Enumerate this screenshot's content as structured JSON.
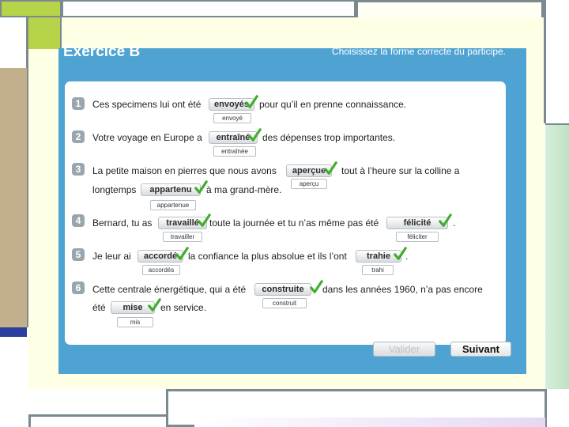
{
  "exercise": {
    "title": "Exercice B",
    "instruction": "Choisissez la forme correcte du participe."
  },
  "questions": [
    {
      "number": "1",
      "text_before": "Ces specimens lui ont été",
      "answer": "envoyés",
      "correction": "envoyé",
      "text_after": "pour qu’il en prenne connaissance."
    },
    {
      "number": "2",
      "text_before": "Votre voyage en Europe a",
      "answer": "entraîné",
      "correction": "entraînée",
      "text_after": "des dépenses trop importantes."
    },
    {
      "number": "3",
      "text_before": "La petite maison en pierres que nous avons",
      "answer": "aperçue",
      "correction": "aperçu",
      "text_after": "tout à l’heure sur la colline a",
      "line2_before": "longtemps",
      "answer2": "appartenu",
      "correction2": "appartenue",
      "line2_after": "à ma grand-mère."
    },
    {
      "number": "4",
      "text_before": "Bernard, tu as",
      "answer": "travaillé",
      "correction": "travailler",
      "text_after": "toute la journée et tu n’as même pas été",
      "answer2": "félicité",
      "correction2": "féliciter",
      "text_end": "."
    },
    {
      "number": "5",
      "text_before": "Je leur ai",
      "answer": "accordé",
      "correction": "accordés",
      "text_after": "la confiance la plus absolue et ils l’ont",
      "answer2": "trahie",
      "correction2": "trahi",
      "text_end": "."
    },
    {
      "number": "6",
      "text_before": "Cette centrale énergétique, qui a été",
      "answer": "construite",
      "correction": "construit",
      "text_after": "dans les années 1960, n’a pas encore",
      "line2_before": "été",
      "answer2": "mise",
      "correction2": "mis",
      "line2_after": "en service."
    }
  ],
  "buttons": {
    "validate": "Valider",
    "next": "Suivant"
  },
  "colors": {
    "frame": "#4fa3d2",
    "check": "#3fae2a",
    "number_badge": "#9aa6ad"
  }
}
